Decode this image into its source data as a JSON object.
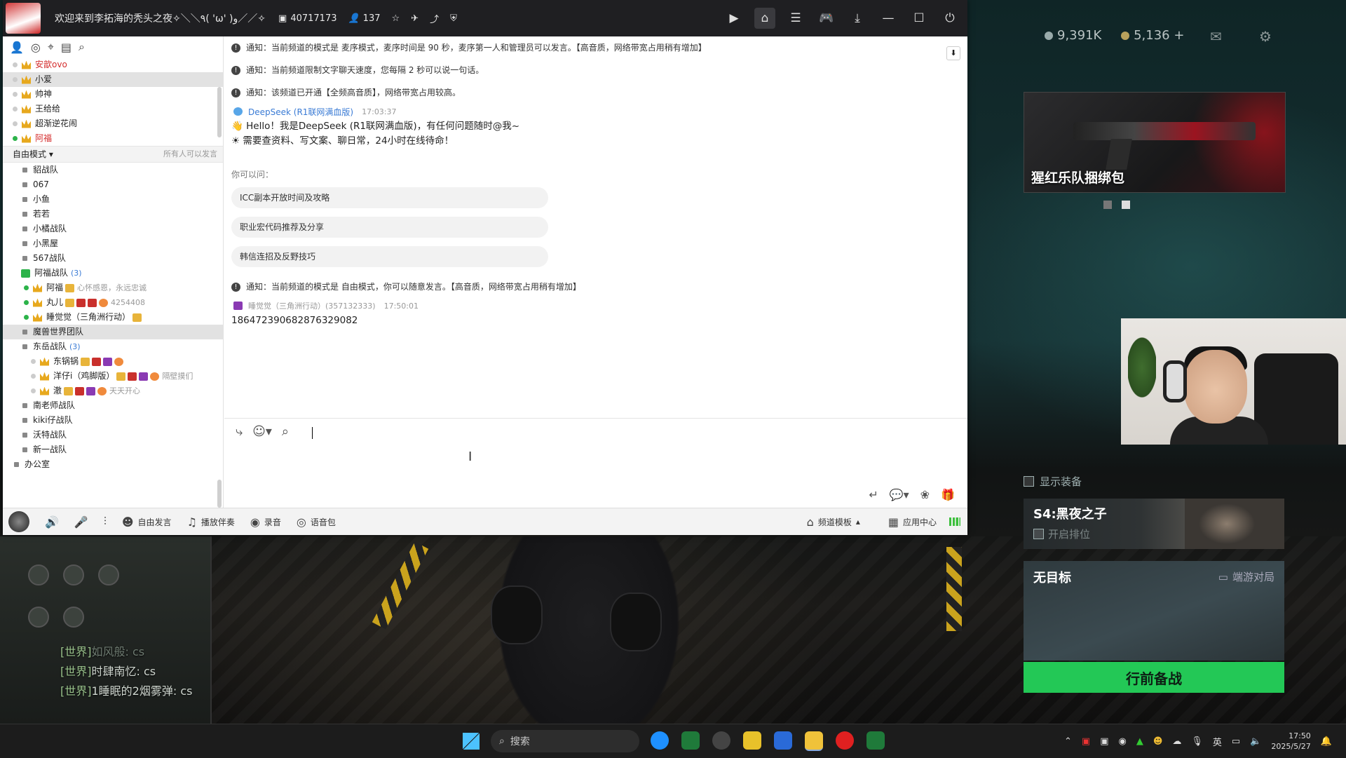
{
  "window": {
    "title": "欢迎来到李拓海的秃头之夜✧＼＼٩( 'ω' )و／／✧",
    "channel_id": "40717173",
    "online_count": "137"
  },
  "sidebar": {
    "users_top": [
      {
        "name": "安歆ovo",
        "color": "red",
        "selected": false
      },
      {
        "name": "小爱",
        "color": "normal",
        "selected": true
      },
      {
        "name": "帅神",
        "color": "normal",
        "selected": false
      },
      {
        "name": "王给给",
        "color": "normal",
        "selected": false
      },
      {
        "name": "超渐逆花闹",
        "color": "normal",
        "selected": false
      },
      {
        "name": "阿福",
        "color": "red",
        "selected": false
      }
    ],
    "mode_label": "自由模式",
    "mode_right": "所有人可以发言",
    "channels": [
      {
        "name": "貂战队"
      },
      {
        "name": "067"
      },
      {
        "name": "小鱼"
      },
      {
        "name": "若若"
      },
      {
        "name": "小橘战队"
      },
      {
        "name": "小黑屋"
      },
      {
        "name": "567战队"
      }
    ],
    "afu_group": {
      "name": "阿福战队",
      "count": "(3)"
    },
    "afu_members": [
      {
        "name": "阿福",
        "note": "心怀感恩，永远忠诚"
      },
      {
        "name": "丸儿",
        "note": "4254408"
      },
      {
        "name": "睡觉觉（三角洲行动）",
        "note": ""
      }
    ],
    "wow_team": "魔兽世界团队",
    "dong_group": {
      "name": "东岳战队",
      "count": "(3)"
    },
    "dong_members": [
      {
        "name": "东锅锅",
        "note": ""
      },
      {
        "name": "洋仔i（鸡脚版）",
        "note": "隔壁摸们"
      },
      {
        "name": "澈",
        "note": "天天开心"
      }
    ],
    "channels_bottom": [
      {
        "name": "南老师战队"
      },
      {
        "name": "kiki仔战队"
      },
      {
        "name": "沃特战队"
      },
      {
        "name": "新一战队"
      }
    ],
    "office": "办公室"
  },
  "chat": {
    "notices_top": [
      "通知：当前频道的模式是 麦序模式，麦序时间是 90 秒，麦序第一人和管理员可以发言。【高音质，网络带宽占用稍有增加】",
      "通知：当前频道限制文字聊天速度，您每隔 2 秒可以说一句话。",
      "通知：该频道已开通【全频高音质】，网络带宽占用较高。"
    ],
    "bot": {
      "name": "DeepSeek (R1联网满血版)",
      "time": "17:03:37",
      "line1": "Hello！我是DeepSeek (R1联网满血版)，有任何问题随时@我~",
      "line2": "需要查资料、写文案、聊日常，24小时在线待命！"
    },
    "suggest_title": "你可以问：",
    "suggestions": [
      "ICC副本开放时间及攻略",
      "职业宏代码推荐及分享",
      "韩信连招及反野技巧"
    ],
    "notice_mode": "通知：当前频道的模式是 自由模式，你可以随意发言。【高音质，网络带宽占用稍有增加】",
    "user_msg": {
      "name": "睡觉觉（三角洲行动）(357132333)",
      "time": "17:50:01",
      "text": "1864723906828763290​82"
    }
  },
  "bottombar": {
    "free_speak": "自由发言",
    "play_music": "播放伴奏",
    "record": "录音",
    "voice_pack": "语音包",
    "channel_template": "频道模板",
    "app_center": "应用中心"
  },
  "game": {
    "currency1": "9,391K",
    "currency2": "5,136 +",
    "promo_label": "猩红乐队捆绑包",
    "show_equipment": "显示装备",
    "season_title": "S4:黑夜之子",
    "season_sub": "开启排位",
    "mission_title": "无目标",
    "mission_mode": "端游对局",
    "go_button": "行前备战",
    "world_chat": [
      {
        "tag": "[世界]",
        "text": "如风般: cs",
        "dim": true
      },
      {
        "tag": "[世界]",
        "text": "时肆南忆: cs",
        "dim": false
      },
      {
        "tag": "[世界]",
        "text": "1睡眠的2烟雾弹: cs",
        "dim": false
      }
    ]
  },
  "taskbar": {
    "search_placeholder": "搜索",
    "ime": "英",
    "time": "17:50",
    "date": "2025/5/27"
  }
}
